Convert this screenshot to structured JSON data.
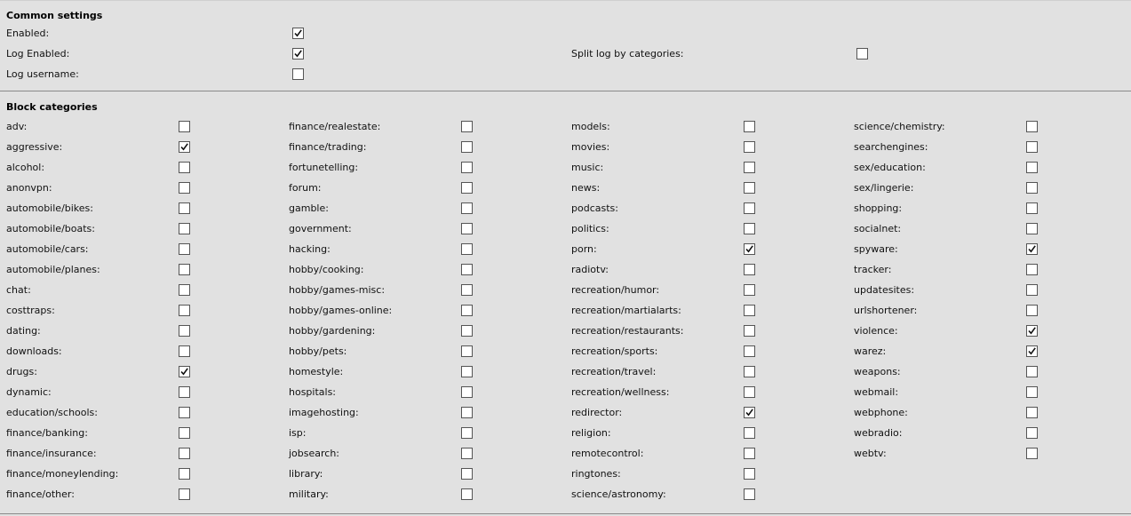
{
  "common": {
    "title": "Common settings",
    "items": [
      {
        "label": "Enabled:",
        "checked": true
      },
      {
        "label": "Log Enabled:",
        "checked": true
      },
      {
        "label": "Log username:",
        "checked": false
      },
      {
        "label": "Split log by categories:",
        "checked": false
      }
    ]
  },
  "block": {
    "title": "Block categories",
    "columns": [
      [
        {
          "label": "adv:",
          "checked": false
        },
        {
          "label": "aggressive:",
          "checked": true
        },
        {
          "label": "alcohol:",
          "checked": false
        },
        {
          "label": "anonvpn:",
          "checked": false
        },
        {
          "label": "automobile/bikes:",
          "checked": false
        },
        {
          "label": "automobile/boats:",
          "checked": false
        },
        {
          "label": "automobile/cars:",
          "checked": false
        },
        {
          "label": "automobile/planes:",
          "checked": false
        },
        {
          "label": "chat:",
          "checked": false
        },
        {
          "label": "costtraps:",
          "checked": false
        },
        {
          "label": "dating:",
          "checked": false
        },
        {
          "label": "downloads:",
          "checked": false
        },
        {
          "label": "drugs:",
          "checked": true
        },
        {
          "label": "dynamic:",
          "checked": false
        },
        {
          "label": "education/schools:",
          "checked": false
        },
        {
          "label": "finance/banking:",
          "checked": false
        },
        {
          "label": "finance/insurance:",
          "checked": false
        },
        {
          "label": "finance/moneylending:",
          "checked": false
        },
        {
          "label": "finance/other:",
          "checked": false
        }
      ],
      [
        {
          "label": "finance/realestate:",
          "checked": false
        },
        {
          "label": "finance/trading:",
          "checked": false
        },
        {
          "label": "fortunetelling:",
          "checked": false
        },
        {
          "label": "forum:",
          "checked": false
        },
        {
          "label": "gamble:",
          "checked": false
        },
        {
          "label": "government:",
          "checked": false
        },
        {
          "label": "hacking:",
          "checked": false
        },
        {
          "label": "hobby/cooking:",
          "checked": false
        },
        {
          "label": "hobby/games-misc:",
          "checked": false
        },
        {
          "label": "hobby/games-online:",
          "checked": false
        },
        {
          "label": "hobby/gardening:",
          "checked": false
        },
        {
          "label": "hobby/pets:",
          "checked": false
        },
        {
          "label": "homestyle:",
          "checked": false
        },
        {
          "label": "hospitals:",
          "checked": false
        },
        {
          "label": "imagehosting:",
          "checked": false
        },
        {
          "label": "isp:",
          "checked": false
        },
        {
          "label": "jobsearch:",
          "checked": false
        },
        {
          "label": "library:",
          "checked": false
        },
        {
          "label": "military:",
          "checked": false
        }
      ],
      [
        {
          "label": "models:",
          "checked": false
        },
        {
          "label": "movies:",
          "checked": false
        },
        {
          "label": "music:",
          "checked": false
        },
        {
          "label": "news:",
          "checked": false
        },
        {
          "label": "podcasts:",
          "checked": false
        },
        {
          "label": "politics:",
          "checked": false
        },
        {
          "label": "porn:",
          "checked": true
        },
        {
          "label": "radiotv:",
          "checked": false
        },
        {
          "label": "recreation/humor:",
          "checked": false
        },
        {
          "label": "recreation/martialarts:",
          "checked": false
        },
        {
          "label": "recreation/restaurants:",
          "checked": false
        },
        {
          "label": "recreation/sports:",
          "checked": false
        },
        {
          "label": "recreation/travel:",
          "checked": false
        },
        {
          "label": "recreation/wellness:",
          "checked": false
        },
        {
          "label": "redirector:",
          "checked": true
        },
        {
          "label": "religion:",
          "checked": false
        },
        {
          "label": "remotecontrol:",
          "checked": false
        },
        {
          "label": "ringtones:",
          "checked": false
        },
        {
          "label": "science/astronomy:",
          "checked": false
        }
      ],
      [
        {
          "label": "science/chemistry:",
          "checked": false
        },
        {
          "label": "searchengines:",
          "checked": false
        },
        {
          "label": "sex/education:",
          "checked": false
        },
        {
          "label": "sex/lingerie:",
          "checked": false
        },
        {
          "label": "shopping:",
          "checked": false
        },
        {
          "label": "socialnet:",
          "checked": false
        },
        {
          "label": "spyware:",
          "checked": true
        },
        {
          "label": "tracker:",
          "checked": false
        },
        {
          "label": "updatesites:",
          "checked": false
        },
        {
          "label": "urlshortener:",
          "checked": false
        },
        {
          "label": "violence:",
          "checked": true
        },
        {
          "label": "warez:",
          "checked": true
        },
        {
          "label": "weapons:",
          "checked": false
        },
        {
          "label": "webmail:",
          "checked": false
        },
        {
          "label": "webphone:",
          "checked": false
        },
        {
          "label": "webradio:",
          "checked": false
        },
        {
          "label": "webtv:",
          "checked": false
        }
      ]
    ]
  }
}
